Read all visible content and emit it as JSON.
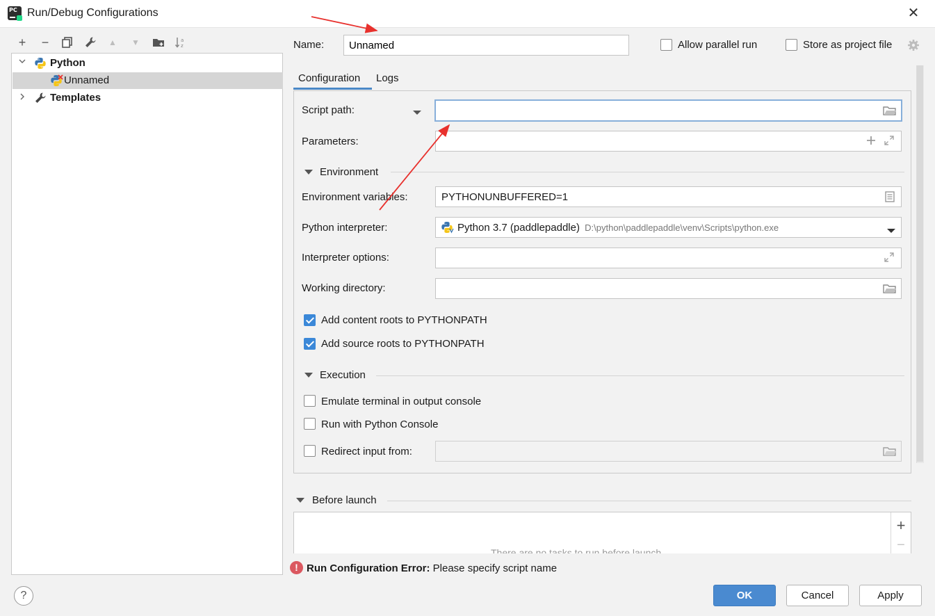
{
  "window": {
    "title": "Run/Debug Configurations",
    "close": "✕",
    "app_icon_text": "PC"
  },
  "toolbar": {
    "add": "+",
    "remove": "−",
    "copy": "⧉",
    "edit_defaults": "🔧",
    "move_up": "▲",
    "move_down": "▼",
    "new_folder": "📁",
    "sort": "↓a z"
  },
  "tree": {
    "python_group": "Python",
    "unnamed_item": "Unnamed",
    "templates": "Templates"
  },
  "header": {
    "name_label": "Name:",
    "name_value": "Unnamed",
    "allow_parallel_label": "Allow parallel run",
    "allow_parallel_checked": false,
    "store_project_label": "Store as project file",
    "store_project_checked": false
  },
  "tabs": {
    "configuration": "Configuration",
    "logs": "Logs"
  },
  "config": {
    "script_path_label": "Script path:",
    "script_path_value": "",
    "parameters_label": "Parameters:",
    "parameters_value": "",
    "environment_section": "Environment",
    "env_vars_label": "Environment variables:",
    "env_vars_value": "PYTHONUNBUFFERED=1",
    "interpreter_label": "Python interpreter:",
    "interpreter_name": "Python 3.7 (paddlepaddle)",
    "interpreter_path": "D:\\python\\paddlepaddle\\venv\\Scripts\\python.exe",
    "interp_options_label": "Interpreter options:",
    "interp_options_value": "",
    "working_dir_label": "Working directory:",
    "working_dir_value": "",
    "content_roots_label": "Add content roots to PYTHONPATH",
    "content_roots_checked": true,
    "source_roots_label": "Add source roots to PYTHONPATH",
    "source_roots_checked": true,
    "execution_section": "Execution",
    "emulate_terminal_label": "Emulate terminal in output console",
    "emulate_terminal_checked": false,
    "python_console_label": "Run with Python Console",
    "python_console_checked": false,
    "redirect_input_label": "Redirect input from:",
    "redirect_input_checked": false
  },
  "before_launch": {
    "section": "Before launch",
    "add": "+",
    "remove": "−",
    "placeholder": "There are no tasks to run before launch"
  },
  "error": {
    "icon": "!",
    "title": "Run Configuration Error:",
    "message": "Please specify script name"
  },
  "footer": {
    "help": "?",
    "ok": "OK",
    "cancel": "Cancel",
    "apply": "Apply"
  },
  "colors": {
    "accent_blue": "#4a8ad0",
    "annotation_red": "#e8312d",
    "error_red": "#db5860"
  }
}
